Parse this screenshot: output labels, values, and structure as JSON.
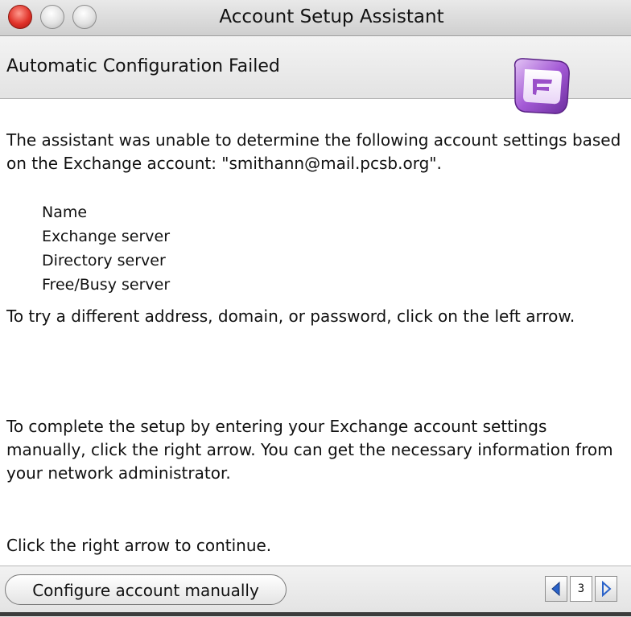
{
  "window": {
    "title": "Account Setup Assistant"
  },
  "header": {
    "title": "Automatic Configuration Failed",
    "icon": "entourage-app-icon"
  },
  "body": {
    "intro": "The assistant was unable to determine the following account settings based on the Exchange account: \"smithann@mail.pcsb.org\".",
    "missing_settings": [
      "Name",
      "Exchange server",
      "Directory server",
      "Free/Busy server"
    ],
    "retry_text": "To try a different address, domain, or password, click on the left arrow.",
    "manual_text": "To complete the setup by entering your Exchange account settings manually, click the right arrow. You can get the necessary information from your network administrator.",
    "continue_text": "Click the right arrow to continue."
  },
  "footer": {
    "manual_button_label": "Configure account manually",
    "page_number": "3"
  },
  "colors": {
    "accent_purple": "#9a4fc9",
    "close_red": "#e0332a"
  }
}
